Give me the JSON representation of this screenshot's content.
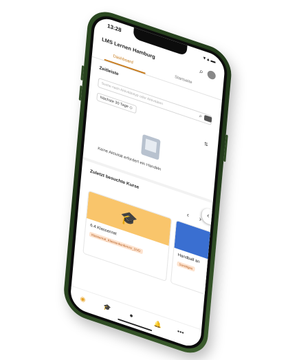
{
  "status": {
    "time": "13:28",
    "icons": "▾ ▴ ▬"
  },
  "header": {
    "title": "LMS Lernen Hamburg",
    "search_icon": "search-icon",
    "avatar": "avatar"
  },
  "tabs": [
    {
      "label": "Dashboard",
      "active": true
    },
    {
      "label": "Startseite",
      "active": false
    }
  ],
  "timeline": {
    "title": "Zeitleiste",
    "search_placeholder": "Suche nach Aktivitätstyp oder Aktivitäten",
    "filter_value": "Nächste 30 Tage ◇",
    "sort_icon": "sort-icon",
    "empty_text": "Keine Aktivität erfordert ein Handeln"
  },
  "recent_courses": {
    "title": "Zuletzt besuchte Kurse",
    "prev": "‹",
    "next": "›",
    "courses": [
      {
        "name": "6.4 Klassenrat",
        "tag": "Klassenrat_Klassenkonferenz_DVD",
        "cover_color": "#f9c56b"
      },
      {
        "name": "Handball an",
        "tag": "Sonstiges",
        "cover_color": "#3a6fd1"
      }
    ]
  },
  "drawer_handle": "‹",
  "bottom_nav": [
    {
      "icon": "dashboard-icon",
      "glyph": "◉",
      "active": true
    },
    {
      "icon": "courses-icon",
      "glyph": "🎓",
      "active": false
    },
    {
      "icon": "messages-icon",
      "glyph": "●",
      "active": false
    },
    {
      "icon": "notifications-icon",
      "glyph": "🔔",
      "active": false
    },
    {
      "icon": "more-icon",
      "glyph": "•••",
      "active": false
    }
  ],
  "colors": {
    "accent": "#c77a1a",
    "phone": "#2c4a22"
  }
}
